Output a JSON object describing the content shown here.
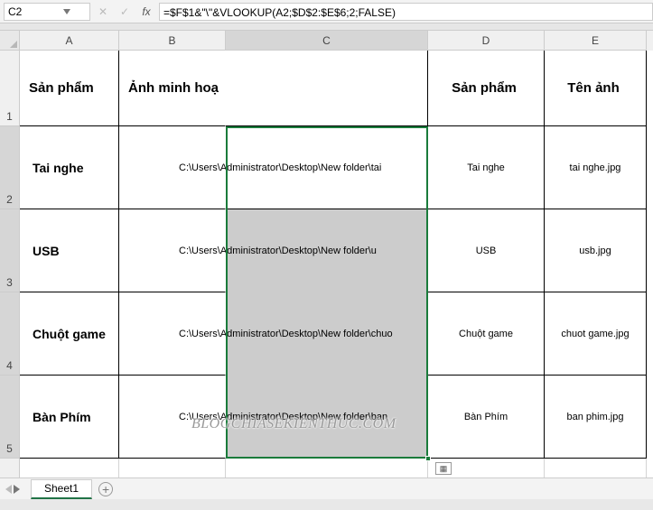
{
  "name_box": "C2",
  "formula": "=$F$1&\"\\\"&VLOOKUP(A2;$D$2:$E$6;2;FALSE)",
  "columns": [
    "A",
    "B",
    "C",
    "D",
    "E"
  ],
  "row_numbers": [
    "1",
    "2",
    "3",
    "4",
    "5"
  ],
  "header_row": {
    "A": "Sản phẩm",
    "B": "Ảnh minh hoạ",
    "D": "Sản phẩm",
    "E": "Tên ảnh"
  },
  "rows": [
    {
      "A": "Tai nghe",
      "BC": "C:\\Users\\Administrator\\Desktop\\New folder\\tai",
      "D": "Tai nghe",
      "E": "tai nghe.jpg"
    },
    {
      "A": "USB",
      "BC": "C:\\Users\\Administrator\\Desktop\\New folder\\u",
      "D": "USB",
      "E": "usb.jpg"
    },
    {
      "A": "Chuột game",
      "BC": "C:\\Users\\Administrator\\Desktop\\New folder\\chuo",
      "D": "Chuột game",
      "E": "chuot game.jpg"
    },
    {
      "A": "Bàn Phím",
      "BC": "C:\\Users\\Administrator\\Desktop\\New folder\\ban",
      "D": "Bàn Phím",
      "E": "ban phim.jpg"
    }
  ],
  "sheet_name": "Sheet1",
  "watermark": "BLOGCHIASEKIENTHUC.COM"
}
